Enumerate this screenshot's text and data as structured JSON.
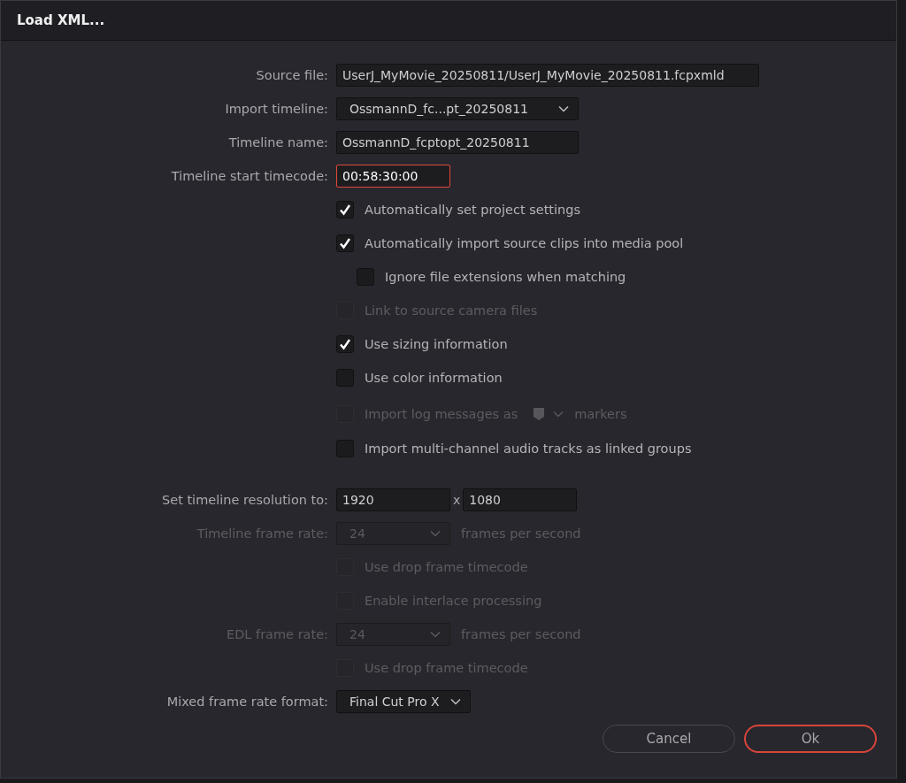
{
  "window": {
    "title": "Load XML..."
  },
  "sections": [
    {
      "rows": [
        {
          "kind": "field",
          "label": "Source file:",
          "value": "UserJ_MyMovie_20250811/UserJ_MyMovie_20250811.fcpxmld",
          "focused": false
        },
        {
          "kind": "dropdown",
          "label": "Import timeline:",
          "value": "OssmannD_fc...pt_20250811",
          "disabled": false
        },
        {
          "kind": "field",
          "label": "Timeline name:",
          "value": "OssmannD_fcptopt_20250811",
          "focused": false
        },
        {
          "kind": "field",
          "label": "Timeline start timecode:",
          "value": "00:58:30:00",
          "focused": true
        },
        {
          "kind": "checkbox",
          "label": "Automatically set project settings",
          "checked": true,
          "disabled": false
        },
        {
          "kind": "checkbox",
          "label": "Automatically import source clips into media pool",
          "checked": true,
          "disabled": false,
          "children": [
            {
              "kind": "checkbox",
              "label": "Ignore file extensions when matching",
              "checked": false,
              "disabled": false
            }
          ]
        },
        {
          "kind": "checkbox",
          "label": "Link to source camera files",
          "checked": false,
          "disabled": true
        },
        {
          "kind": "checkbox",
          "label": "Use sizing information",
          "checked": true,
          "disabled": false
        },
        {
          "kind": "checkbox",
          "label": "Use color information",
          "checked": false,
          "disabled": false
        },
        {
          "kind": "log",
          "label": "Import log messages as",
          "suffix": "markers",
          "checked": false,
          "disabled": true
        },
        {
          "kind": "checkbox",
          "label": "Import multi-channel audio tracks as linked groups",
          "checked": false,
          "disabled": false
        }
      ]
    },
    {
      "rows": [
        {
          "kind": "pair",
          "label": "Set timeline resolution to:",
          "values": [
            "1920",
            "1080"
          ],
          "separator": "x"
        },
        {
          "kind": "dropdown",
          "label": "Timeline frame rate:",
          "value": "24",
          "disabled": true,
          "suffix": "frames per second"
        },
        {
          "kind": "checkbox",
          "label": "Use drop frame timecode",
          "checked": false,
          "disabled": true
        },
        {
          "kind": "checkbox",
          "label": "Enable interlace processing",
          "checked": false,
          "disabled": true
        },
        {
          "kind": "dropdown",
          "label": "EDL frame rate:",
          "value": "24",
          "disabled": true,
          "suffix": "frames per second"
        },
        {
          "kind": "checkbox",
          "label": "Use drop frame timecode",
          "checked": false,
          "disabled": true
        },
        {
          "kind": "dropdown",
          "label": "Mixed frame rate format:",
          "value": "Final Cut Pro X",
          "disabled": false
        }
      ]
    }
  ],
  "buttons": [
    {
      "label": "Cancel",
      "default": false
    },
    {
      "label": "Ok",
      "default": true
    }
  ]
}
